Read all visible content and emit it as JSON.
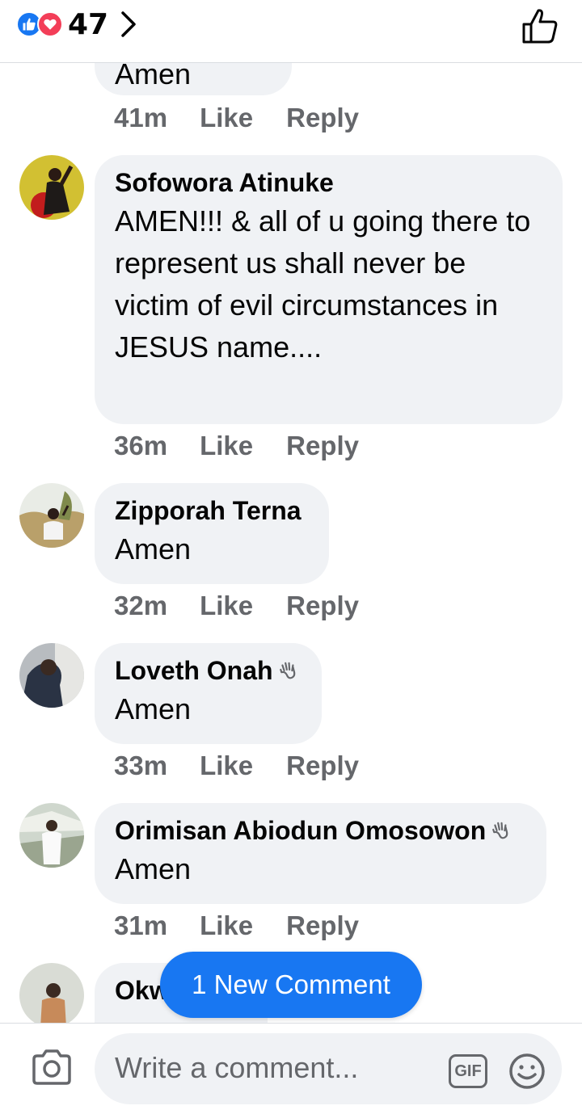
{
  "header": {
    "reaction_count": "47",
    "reaction_icons": [
      "like-icon",
      "love-icon"
    ],
    "like_button_icon": "thumbs-up-outline-icon"
  },
  "colors": {
    "accent": "#1877f2",
    "love": "#f33e58",
    "bubble": "#f0f2f5",
    "meta_text": "#65676b"
  },
  "comments": [
    {
      "name": "",
      "text": "Amen",
      "time": "41m",
      "like": "Like",
      "reply": "Reply"
    },
    {
      "name": "Sofowora Atinuke",
      "text": "AMEN!!! & all of u going there to represent us shall never be victim of evil circumstances in JESUS name....",
      "time": "36m",
      "like": "Like",
      "reply": "Reply"
    },
    {
      "name": "Zipporah Terna",
      "text": "Amen",
      "time": "32m",
      "like": "Like",
      "reply": "Reply"
    },
    {
      "name": "Loveth Onah",
      "badge": "wave-icon",
      "text": "Amen",
      "time": "33m",
      "like": "Like",
      "reply": "Reply"
    },
    {
      "name": "Orimisan Abiodun Omosowon",
      "badge": "wave-icon",
      "text": "Amen",
      "time": "31m",
      "like": "Like",
      "reply": "Reply"
    },
    {
      "name": "Okw",
      "text": ""
    }
  ],
  "new_comment_pill": "1 New Comment",
  "composer": {
    "placeholder": "Write a comment...",
    "gif_label": "GIF",
    "camera_icon": "camera-icon",
    "emoji_icon": "smiley-icon"
  }
}
